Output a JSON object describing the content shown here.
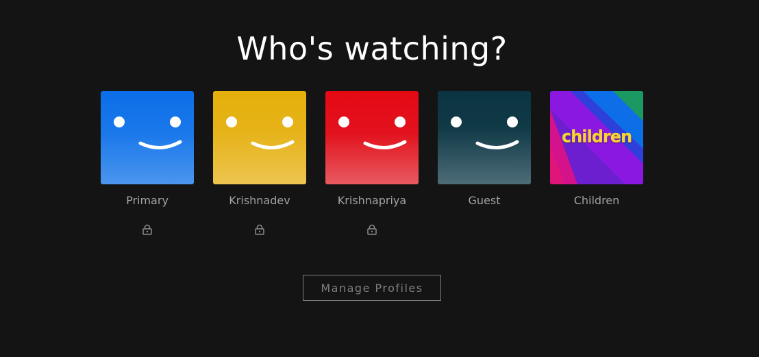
{
  "heading": "Who's watching?",
  "profiles": [
    {
      "name": "Primary",
      "avatar": "smiley-face",
      "color": "#0b6ee8",
      "locked": true,
      "lock_icon": "lock-icon"
    },
    {
      "name": "Krishnadev",
      "avatar": "smiley-face",
      "color": "#e4b00b",
      "locked": true,
      "lock_icon": "lock-icon"
    },
    {
      "name": "Krishnapriya",
      "avatar": "smiley-face",
      "color": "#e50914",
      "locked": true,
      "lock_icon": "lock-icon"
    },
    {
      "name": "Guest",
      "avatar": "smiley-face",
      "color": "#0b3442",
      "locked": false
    },
    {
      "name": "Children",
      "avatar": "children-logo",
      "avatar_text": "children",
      "color": "#6b1fcf",
      "locked": false
    }
  ],
  "manage_button": "Manage Profiles",
  "colors": {
    "background": "#141414",
    "heading": "#ffffff",
    "profile_name": "#a3a3a3",
    "button_border": "#808080"
  }
}
